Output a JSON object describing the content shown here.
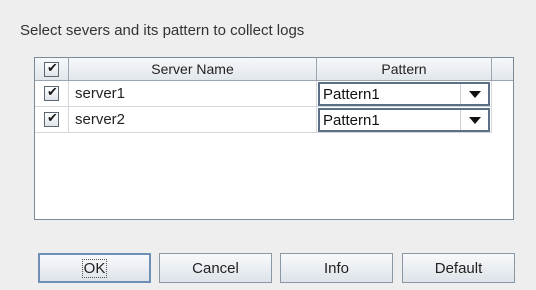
{
  "dialog": {
    "instruction": "Select severs and its pattern to collect logs"
  },
  "table": {
    "columns": [
      "Server Name",
      "Pattern"
    ],
    "header_checked": true,
    "rows": [
      {
        "checked": true,
        "server": "server1",
        "pattern": "Pattern1"
      },
      {
        "checked": true,
        "server": "server2",
        "pattern": "Pattern1"
      }
    ]
  },
  "buttons": {
    "ok": "OK",
    "cancel": "Cancel",
    "info": "Info",
    "default": "Default"
  },
  "icons": {
    "check": "✔",
    "dropdown": "chevron-down-icon"
  }
}
